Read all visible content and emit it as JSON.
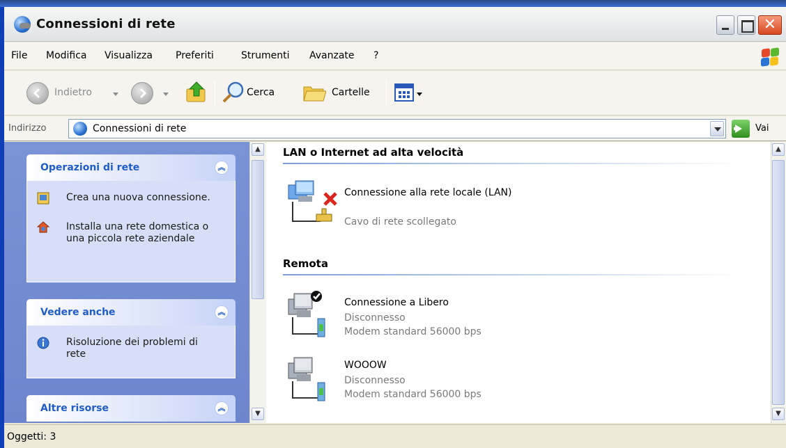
{
  "window": {
    "title": "Connessioni di rete"
  },
  "menu": {
    "items": [
      "File",
      "Modifica",
      "Visualizza",
      "Preferiti",
      "Strumenti",
      "Avanzate",
      "?"
    ]
  },
  "toolbar": {
    "back_label": "Indietro",
    "search_label": "Cerca",
    "folders_label": "Cartelle"
  },
  "address": {
    "label": "Indirizzo",
    "value": "Connessioni di rete",
    "go_label": "Vai"
  },
  "sidebar": {
    "panels": [
      {
        "title": "Operazioni di rete",
        "tasks": [
          "Crea una nuova connessione.",
          "Installa una rete domestica o una piccola rete aziendale"
        ]
      },
      {
        "title": "Vedere anche",
        "tasks": [
          "Risoluzione dei problemi di rete"
        ]
      },
      {
        "title": "Altre risorse",
        "tasks": []
      }
    ]
  },
  "groups": [
    {
      "title": "LAN o Internet ad alta velocità",
      "items": [
        {
          "name": "Connessione alla rete locale (LAN)",
          "status": "Cavo di rete scollegato",
          "icon": "lan-disconnected-icon"
        }
      ]
    },
    {
      "title": "Remota",
      "items": [
        {
          "name": "Connessione a Libero",
          "status": "Disconnesso",
          "device": "Modem standard 56000 bps",
          "icon": "dialup-connection-icon",
          "default": true
        },
        {
          "name": "WOOOW",
          "status": "Disconnesso",
          "device": "Modem standard 56000 bps",
          "icon": "dialup-connection-icon"
        }
      ]
    }
  ],
  "status": {
    "text": "Oggetti: 3"
  }
}
